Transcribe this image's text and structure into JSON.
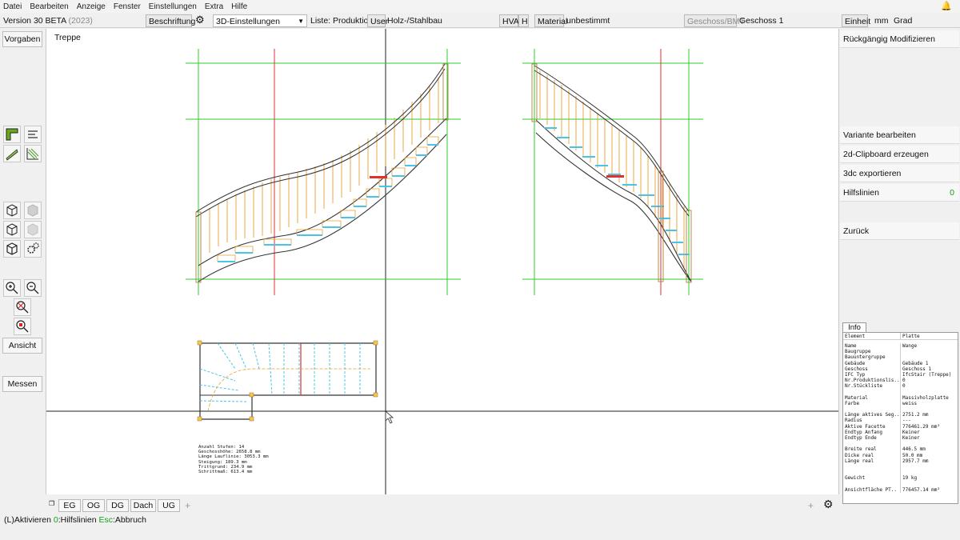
{
  "menu": [
    "Datei",
    "Bearbeiten",
    "Anzeige",
    "Fenster",
    "Einstellungen",
    "Extra",
    "Hilfe"
  ],
  "toolbar": {
    "version": "Version 30 BETA",
    "year": "(2023)",
    "beschriftung": "Beschriftung",
    "view_select": "3D-Einstellungen",
    "liste": "Liste: Produktion",
    "user": "User",
    "user_value": "Holz-/Stahlbau",
    "hva": "HVA",
    "h": "H",
    "material": "Material",
    "material_value": "unbestimmt",
    "geschoss_btn": "Geschoss/BMT",
    "geschoss_value": "Geschoss 1",
    "einheit": "Einheit",
    "unit_mm": "mm",
    "unit_grad": "Grad"
  },
  "left": {
    "vorgaben": "Vorgaben",
    "ansicht": "Ansicht",
    "messen": "Messen"
  },
  "canvas": {
    "title": "Treppe",
    "stair_info": [
      "Anzahl Stufen: 14",
      "Geschosshöhe: 2658.8 mm",
      "Länge Lauflinie: 3053.3 mm",
      "Steigung: 189.3 mm",
      "Trittgrund: 234.9 mm",
      "Schrittmaß: 613.4 mm"
    ]
  },
  "right": {
    "undo": "Rückgängig Modifizieren",
    "variante": "Variante bearbeiten",
    "clipboard": "2d-Clipboard erzeugen",
    "export": "3dc exportieren",
    "hilfslinien": "Hilfslinien",
    "hilfslinien_count": "0",
    "zurueck": "Zurück",
    "info_tab": "Info"
  },
  "info": {
    "header": [
      "Element",
      "Platte"
    ],
    "rows": [
      [
        "Name",
        "Wange"
      ],
      [
        "Baugruppe",
        ""
      ],
      [
        "Bauuntergruppe",
        ""
      ],
      [
        "Gebäude",
        "Gebäude 1"
      ],
      [
        "Geschoss",
        "Geschoss 1"
      ],
      [
        "IFC Typ",
        "IfcStair (Treppe)"
      ],
      [
        "Nr.Produktionslis..",
        "0"
      ],
      [
        "Nr.Stückliste",
        "0"
      ],
      [
        "",
        ""
      ],
      [
        "Material",
        "Massivholzplatte"
      ],
      [
        "Farbe",
        "weiss"
      ],
      [
        "",
        ""
      ],
      [
        "Länge aktives Seg..",
        "2751.2 mm"
      ],
      [
        "Radius",
        "---"
      ],
      [
        "Aktive Facette",
        "776461.29 mm²"
      ],
      [
        "Endtyp Anfang",
        "Keiner"
      ],
      [
        "Endtyp Ende",
        "Keiner"
      ],
      [
        "",
        ""
      ],
      [
        "Breite real",
        "446.5 mm"
      ],
      [
        "Dicke real",
        "50.0 mm"
      ],
      [
        "Länge real",
        "2957.7 mm"
      ],
      [
        "",
        ""
      ],
      [
        "",
        ""
      ],
      [
        "Gewicht",
        "19 kg"
      ],
      [
        "",
        ""
      ],
      [
        "Ansichtfläche PT..",
        "776457.14 mm²"
      ]
    ]
  },
  "tabs": [
    "EG",
    "OG",
    "DG",
    "Dach",
    "UG"
  ],
  "tab_add": "+",
  "status": {
    "l": "(L)Aktivieren",
    "zero": "0",
    "zero_label": ":Hilfslinien",
    "esc": "Esc",
    "esc_label": ":Abbruch"
  },
  "colors": {
    "grid_green": "#2ecc2e",
    "red_line": "#e03030",
    "stringer_yellow": "#e8a030",
    "tread_cyan": "#49c4e8"
  }
}
